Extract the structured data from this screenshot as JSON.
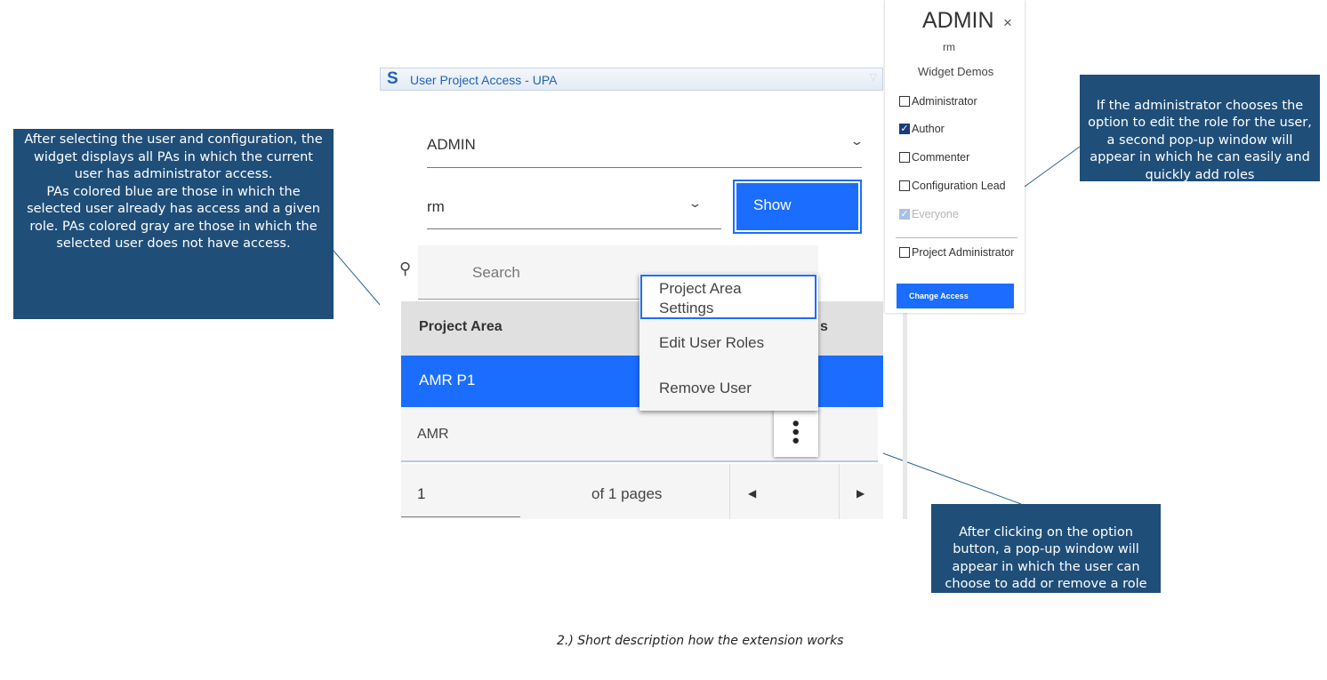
{
  "widget": {
    "logo": "S",
    "title": "User Project Access - UPA",
    "collapse_icon": "▽",
    "user_select": "ADMIN",
    "config_select": "rm",
    "show_label": "Show",
    "search_placeholder": "Search",
    "table_header": "Project Area",
    "table_header_tail": "s",
    "rows": [
      {
        "label": "AMR P1",
        "state": "has-access",
        "color": "#1a6dff"
      },
      {
        "label": "AMR",
        "state": "no-access",
        "color": "#f5f5f5"
      }
    ],
    "pager": {
      "page": "1",
      "of_pages": "of 1 pages"
    }
  },
  "context_menu": {
    "items": [
      "Project Area\nSettings",
      "Edit User Roles",
      "Remove User"
    ]
  },
  "roles_popup": {
    "title": "ADMIN",
    "close": "×",
    "user": "rm",
    "project": "Widget Demos",
    "roles": [
      {
        "label": "Administrator",
        "checked": false,
        "disabled": false
      },
      {
        "label": "Author",
        "checked": true,
        "disabled": false
      },
      {
        "label": "Commenter",
        "checked": false,
        "disabled": false
      },
      {
        "label": "Configuration Lead",
        "checked": false,
        "disabled": false
      },
      {
        "label": "Everyone",
        "checked": true,
        "disabled": true
      },
      {
        "label": "Project Administrator",
        "checked": false,
        "disabled": false
      }
    ],
    "change_button": "Change Access"
  },
  "callouts": {
    "left": "After selecting the user and configuration, the widget displays all PAs in which the current user has administrator access.\nPAs colored blue are those in which the selected user already has access and a given role. PAs colored gray are those in which the selected user does not have access.",
    "right": "If the administrator chooses the option to edit the role for the user, a second pop-up window will appear in which he can easily and quickly add roles",
    "bottom": "After clicking on the option button, a pop-up window will appear in which the user can choose to add or remove a role"
  },
  "caption": "2.) Short description how the extension works",
  "colors": {
    "callout": "#1f4e79",
    "accent": "#1a6dff"
  }
}
